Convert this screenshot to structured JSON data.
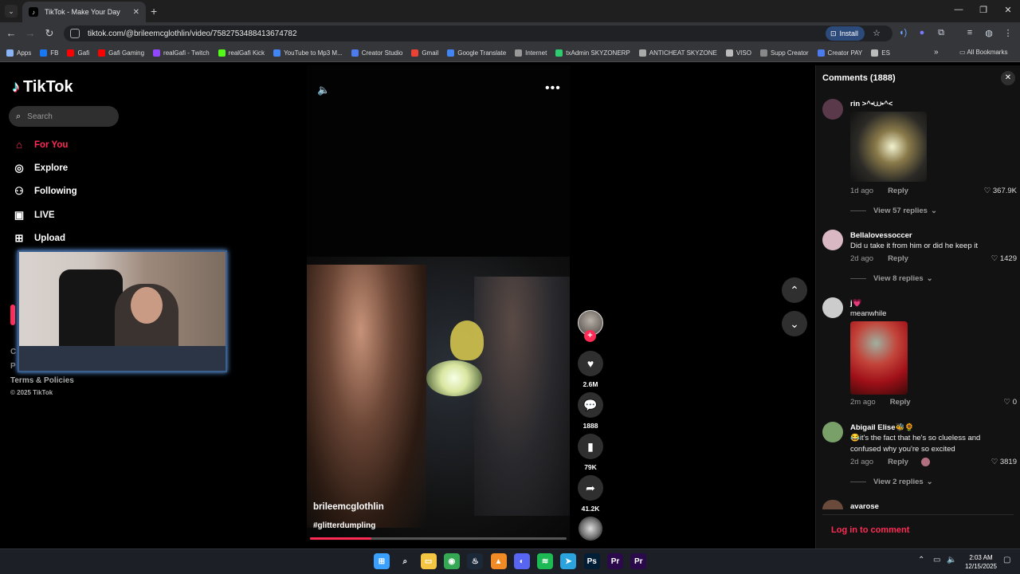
{
  "browser": {
    "tab_title": "TikTok - Make Your Day",
    "tab_close": "✕",
    "new_tab": "+",
    "url": "tiktok.com/@brileemcglothlin/video/7582753488413674782",
    "install_label": "Install",
    "bookmarks": [
      {
        "label": "Apps",
        "color": "#8ab4f8"
      },
      {
        "label": "FB",
        "color": "#1877f2"
      },
      {
        "label": "Gafi",
        "color": "#ff0000"
      },
      {
        "label": "Gafi Gaming",
        "color": "#ff0000"
      },
      {
        "label": "realGafi - Twitch",
        "color": "#9146ff"
      },
      {
        "label": "realGafi Kick",
        "color": "#53fc18"
      },
      {
        "label": "YouTube to Mp3 M...",
        "color": "#4285f4"
      },
      {
        "label": "Creator Studio",
        "color": "#4b7bec"
      },
      {
        "label": "Gmail",
        "color": "#ea4335"
      },
      {
        "label": "Google Translate",
        "color": "#4285f4"
      },
      {
        "label": "Internet",
        "color": "#999999"
      },
      {
        "label": "txAdmin SKYZONERP",
        "color": "#2ecc71"
      },
      {
        "label": "ANTICHEAT SKYZONE",
        "color": "#aaaaaa"
      },
      {
        "label": "VISO",
        "color": "#bbbbbb"
      },
      {
        "label": "Supp Creator",
        "color": "#888888"
      },
      {
        "label": "Creator PAY",
        "color": "#4b7bec"
      },
      {
        "label": "ES",
        "color": "#bbbbbb"
      }
    ],
    "all_bookmarks": "All Bookmarks"
  },
  "sidebar": {
    "logo": "TikTok",
    "search_placeholder": "Search",
    "nav": [
      {
        "label": "For You",
        "icon": "home-icon",
        "color": "#fe2c55"
      },
      {
        "label": "Explore",
        "icon": "compass-icon",
        "color": "#ffffff"
      },
      {
        "label": "Following",
        "icon": "following-icon",
        "color": "#ffffff"
      },
      {
        "label": "LIVE",
        "icon": "live-icon",
        "color": "#ffffff"
      },
      {
        "label": "Upload",
        "icon": "upload-icon",
        "color": "#ffffff"
      }
    ],
    "terms": "Terms & Policies",
    "copyright": "© 2025 TikTok",
    "obscured_c": "C",
    "obscured_p": "P"
  },
  "video": {
    "author": "brileemcglothlin",
    "hashtag": "#glitterdumpling",
    "progress": 0.24,
    "likes": "2.6M",
    "comments": "1888",
    "saves": "79K",
    "shares": "41.2K"
  },
  "comments_panel": {
    "title": "Comments (1888)",
    "items": [
      {
        "user": "rin >^•⩊•^<",
        "text": "",
        "time": "1d ago",
        "reply": "Reply",
        "likes": "367.9K",
        "view_replies": "View 57 replies",
        "avatar_color": "#5a3a4a"
      },
      {
        "user": "Bellalovessoccer",
        "text": "Did u take it from him or did he keep it",
        "time": "2d ago",
        "reply": "Reply",
        "likes": "1429",
        "view_replies": "View 8 replies",
        "avatar_color": "#d9b8c4"
      },
      {
        "user": "j💗",
        "text": "meanwhile",
        "time": "2m ago",
        "reply": "Reply",
        "likes": "0",
        "avatar_color": "#cccccc"
      },
      {
        "user": "Abigail Elise🐝🌻",
        "text": "😂it's the fact that he's so clueless and confused why you're so excited",
        "time": "2d ago",
        "reply": "Reply",
        "likes": "3819",
        "view_replies": "View 2 replies",
        "avatar_color": "#7aa06a"
      },
      {
        "user": "avarose",
        "avatar_color": "#6a4a3a"
      }
    ],
    "login": "Log in to comment"
  },
  "taskbar": {
    "time": "2:03 AM",
    "date": "12/15/2025",
    "apps": [
      {
        "name": "start",
        "color": "#3aa0ff",
        "glyph": "⊞"
      },
      {
        "name": "search",
        "color": "transparent",
        "glyph": "⌕"
      },
      {
        "name": "explorer",
        "color": "#f4c542",
        "glyph": "▭"
      },
      {
        "name": "chrome",
        "color": "#34a853",
        "glyph": "◉"
      },
      {
        "name": "steam",
        "color": "#1b2838",
        "glyph": "♨"
      },
      {
        "name": "vlc",
        "color": "#f08a24",
        "glyph": "▲"
      },
      {
        "name": "discord",
        "color": "#5865f2",
        "glyph": "◐"
      },
      {
        "name": "spotify",
        "color": "#1db954",
        "glyph": "≋"
      },
      {
        "name": "telegram",
        "color": "#2aa3df",
        "glyph": "➤"
      },
      {
        "name": "photoshop",
        "color": "#001e36",
        "glyph": "Ps"
      },
      {
        "name": "premiere",
        "color": "#2a0a4a",
        "glyph": "Pr"
      },
      {
        "name": "premiere-2",
        "color": "#2a0a4a",
        "glyph": "Pr"
      }
    ]
  }
}
